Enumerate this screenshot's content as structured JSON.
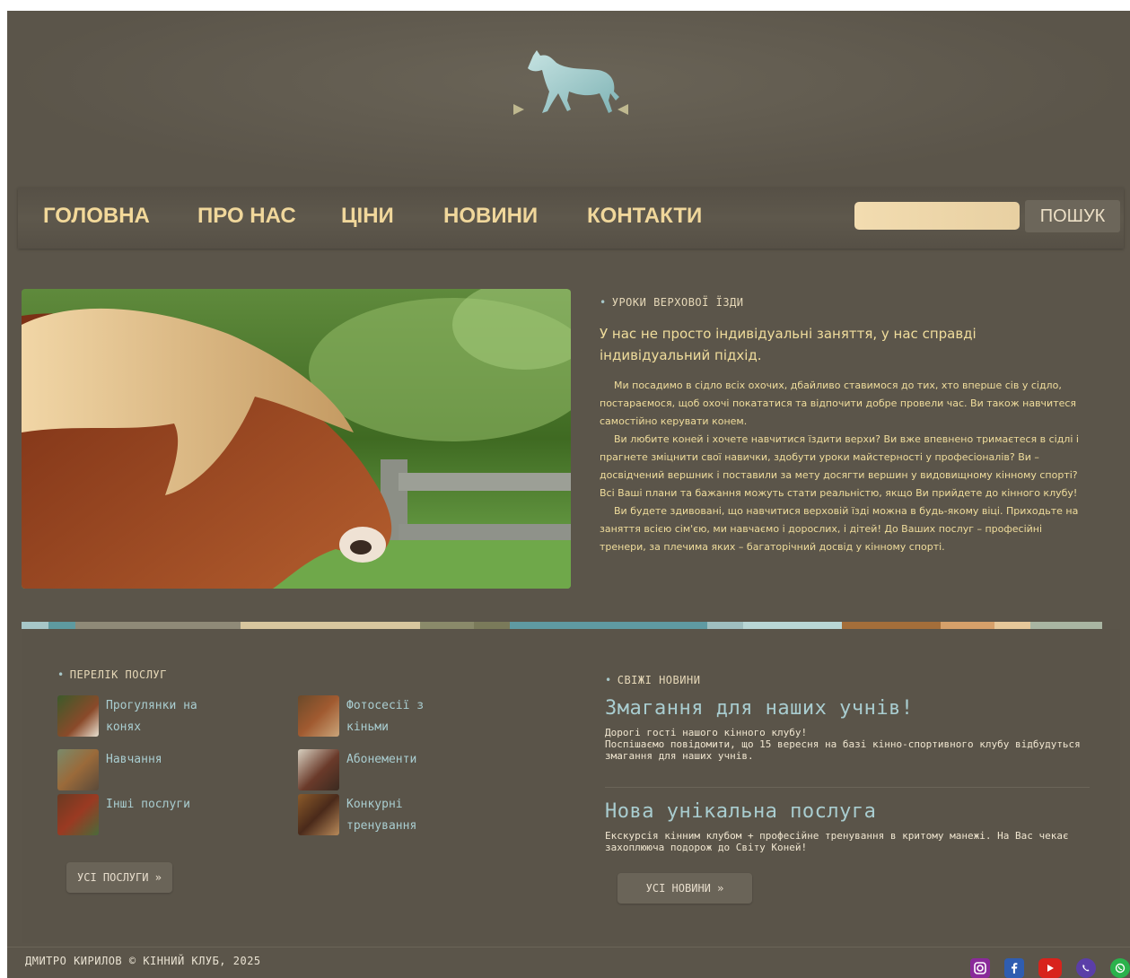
{
  "nav": {
    "items": [
      "ГОЛОВНА",
      "ПРО НАС",
      "ЦІНИ",
      "НОВИНИ",
      "КОНТАКТИ"
    ],
    "search_placeholder": "",
    "search_button": "ПОШУК"
  },
  "hero": {
    "label": "УРОКИ ВЕРХОВОЇ ЇЗДИ",
    "headline": "У нас не просто індивідуальні заняття, у нас справді індивідуальний підхід.",
    "paragraphs": [
      "Ми посадимо в сідло всіх охочих, дбайливо ставимося до тих, хто вперше сів у сідло, постараємося, щоб охочі покататися та відпочити добре провели час. Ви також навчитеся самостійно керувати конем.",
      "Ви любите коней і хочете навчитися їздити верхи? Ви вже впевнено тримаєтеся в сідлі і прагнете зміцнити свої навички, здобути уроки майстерності у професіоналів? Ви – досвідчений вершник і поставили за мету досягти вершин у видовищному кінному спорті? Всі Ваші плани та бажання можуть стати реальністю, якщо Ви прийдете до кінного клубу!",
      "Ви будете здивовані, що навчитися верховій їзді можна в будь-якому віці. Приходьте на заняття всією сім'єю, ми навчаємо і дорослих, і дітей! До Ваших послуг – професійні тренери, за плечима яких – багаторічний досвід у кінному спорті."
    ]
  },
  "services": {
    "label": "ПЕРЕЛІК ПОСЛУГ",
    "items": [
      {
        "label": "Прогулянки на конях"
      },
      {
        "label": "Фотосесії з кіньми"
      },
      {
        "label": "Навчання"
      },
      {
        "label": "Абонементи"
      },
      {
        "label": "Інші послуги"
      },
      {
        "label": "Конкурні тренування"
      }
    ],
    "all_button": "УСІ ПОСЛУГИ »"
  },
  "news": {
    "label": "СВІЖІ НОВИНИ",
    "items": [
      {
        "title": "Змагання для наших учнів!",
        "body": "Дорогі гості нашого кінного клубу!\nПоспішаємо повідомити, що 15 вересня на базі кінно-спортивного клубу відбудуться змагання для наших учнів."
      },
      {
        "title": "Нова унікальна послуга",
        "body": "Екскурсія кінним клубом + професійне тренування в критому манежі. На Вас чекає захоплююча подорож до Світу Коней!"
      }
    ],
    "all_button": "УСІ НОВИНИ »"
  },
  "footer": {
    "copyright": "ДМИТРО КИРИЛОВ © КІННИЙ КЛУБ, 2025",
    "socials": [
      "instagram-icon",
      "facebook-icon",
      "youtube-icon",
      "viber-icon",
      "whatsapp-icon"
    ]
  },
  "colors": {
    "background": "#5b554a",
    "nav_text": "#f0d79b",
    "accent_teal": "#a9cdd0",
    "body_text": "#f0dd9c"
  }
}
